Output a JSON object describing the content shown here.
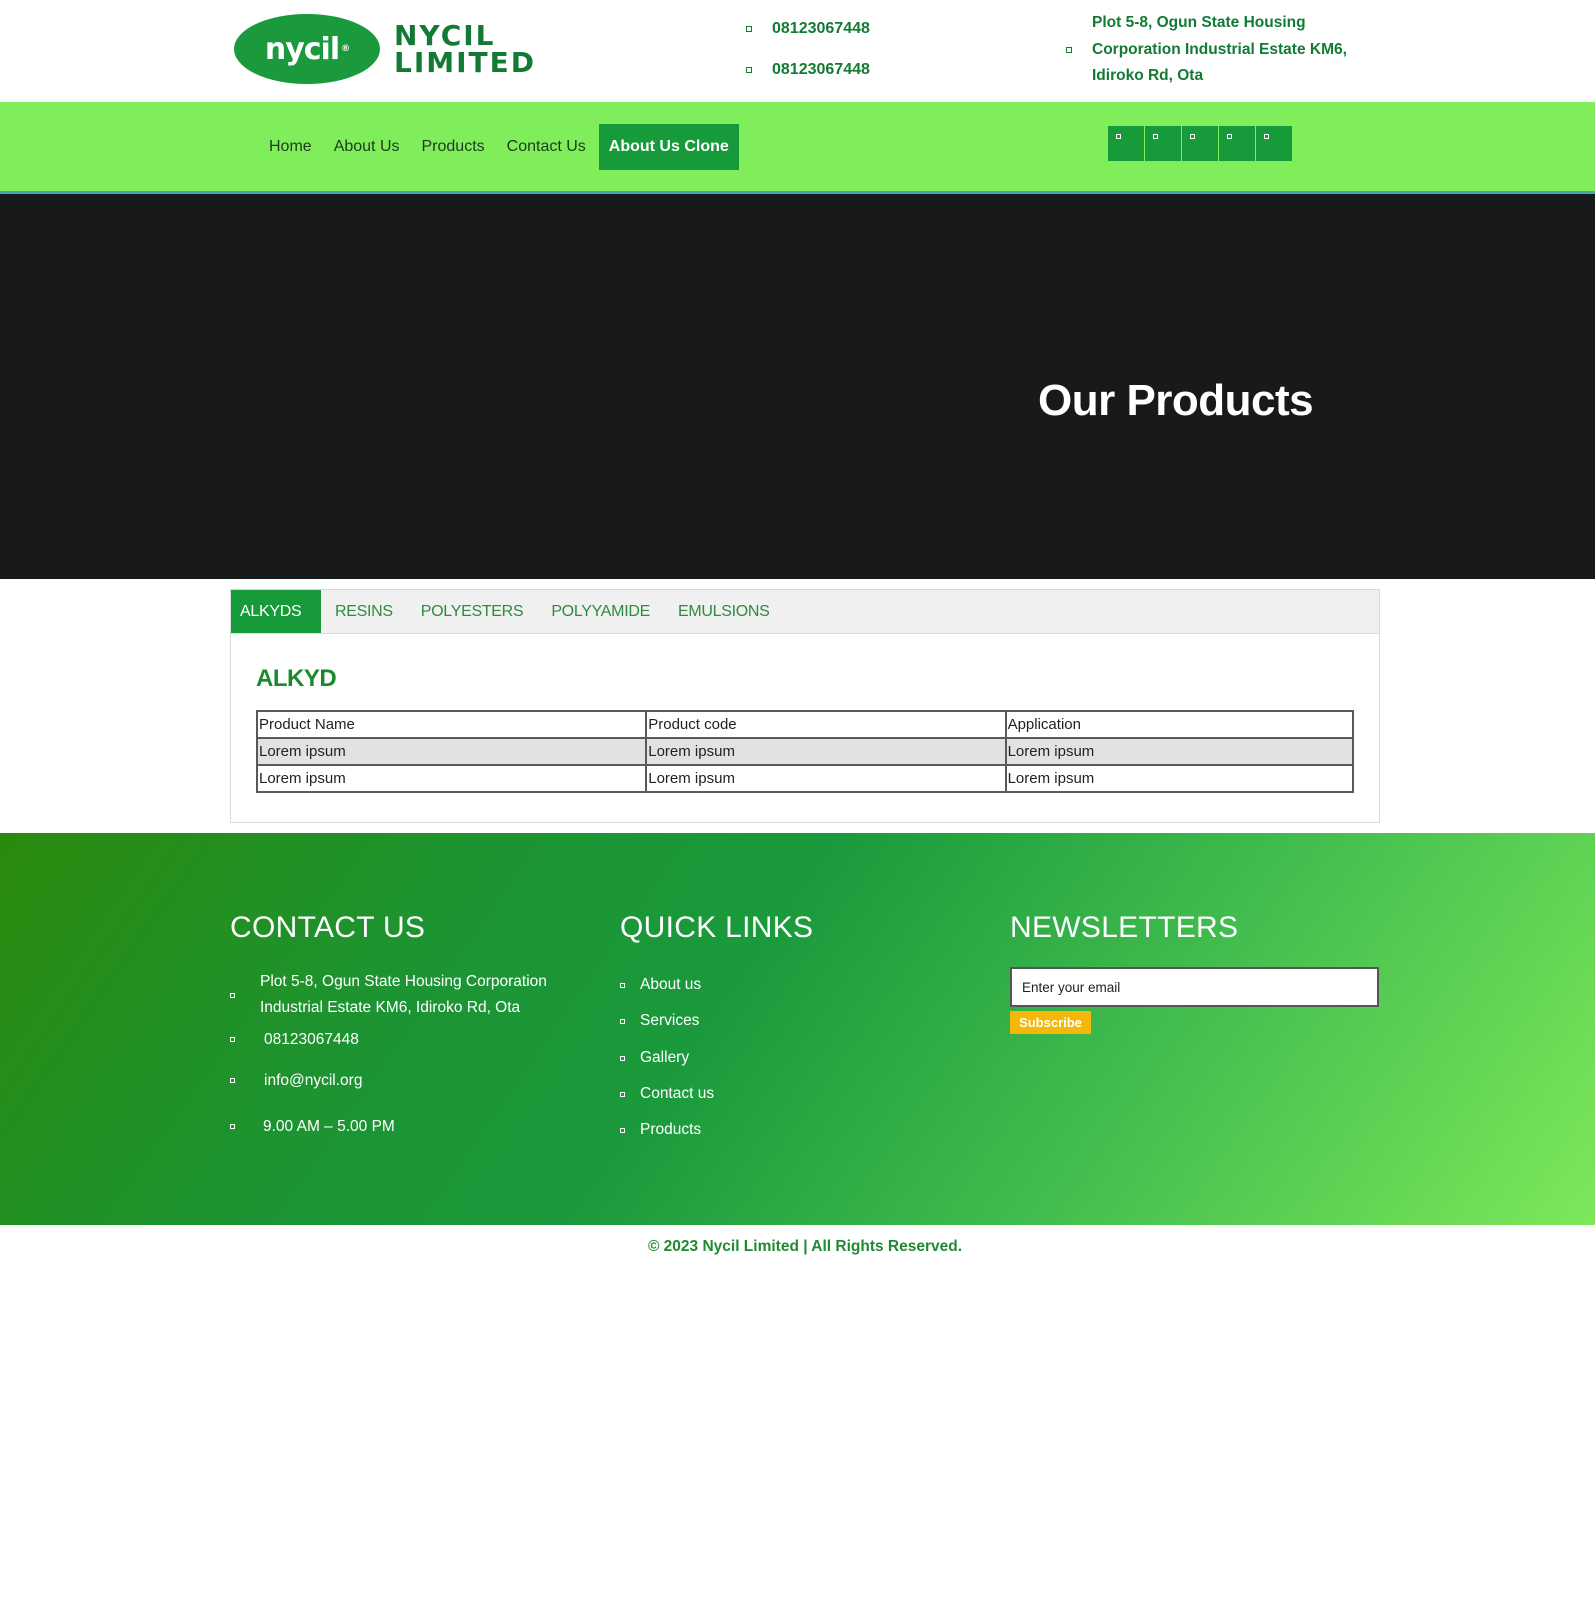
{
  "brand": {
    "logo_mark": "nycil",
    "logo_registered": "®",
    "logo_line1": "NYCIL",
    "logo_line2": "LIMITED"
  },
  "header": {
    "phone1": "08123067448",
    "phone2": "08123067448",
    "address": "Plot 5-8, Ogun State Housing Corporation Industrial Estate KM6, Idiroko Rd, Ota"
  },
  "nav": {
    "items": [
      {
        "label": "Home"
      },
      {
        "label": "About Us"
      },
      {
        "label": "Products"
      },
      {
        "label": "Contact Us"
      },
      {
        "label": "About Us Clone",
        "active": true
      }
    ],
    "social_icons": [
      "facebook-icon",
      "twitter-icon",
      "instagram-icon",
      "linkedin-icon",
      "youtube-icon"
    ]
  },
  "hero": {
    "title": "Our Products"
  },
  "products": {
    "tabs": [
      {
        "label": "ALKYDS",
        "active": true
      },
      {
        "label": "RESINS"
      },
      {
        "label": "POLYESTERS"
      },
      {
        "label": "POLYYAMIDE"
      },
      {
        "label": "EMULSIONS"
      }
    ],
    "section_title": "ALKYD",
    "columns": [
      "Product Name",
      "Product code",
      "Application"
    ],
    "rows": [
      [
        "Lorem ipsum",
        "Lorem ipsum",
        "Lorem ipsum"
      ],
      [
        "Lorem ipsum",
        "Lorem ipsum",
        "Lorem ipsum"
      ]
    ]
  },
  "footer": {
    "contact": {
      "heading": "CONTACT US",
      "address": "Plot 5-8, Ogun State Housing Corporation Industrial Estate KM6, Idiroko Rd, Ota",
      "phone": "08123067448",
      "email": "info@nycil.org",
      "hours": "9.00 AM – 5.00 PM"
    },
    "quick_links": {
      "heading": "QUICK LINKS",
      "items": [
        "About us",
        "Services",
        "Gallery",
        "Contact us",
        "Products"
      ]
    },
    "newsletter": {
      "heading": "NEWSLETTERS",
      "placeholder": "Enter your email",
      "button": "Subscribe"
    }
  },
  "copyright": "© 2023 Nycil Limited | All Rights Reserved.",
  "colors": {
    "brand_green": "#169a3a",
    "nav_bg": "#80ee5a",
    "hero_bg": "#18191b",
    "subscribe": "#f5b70a"
  }
}
